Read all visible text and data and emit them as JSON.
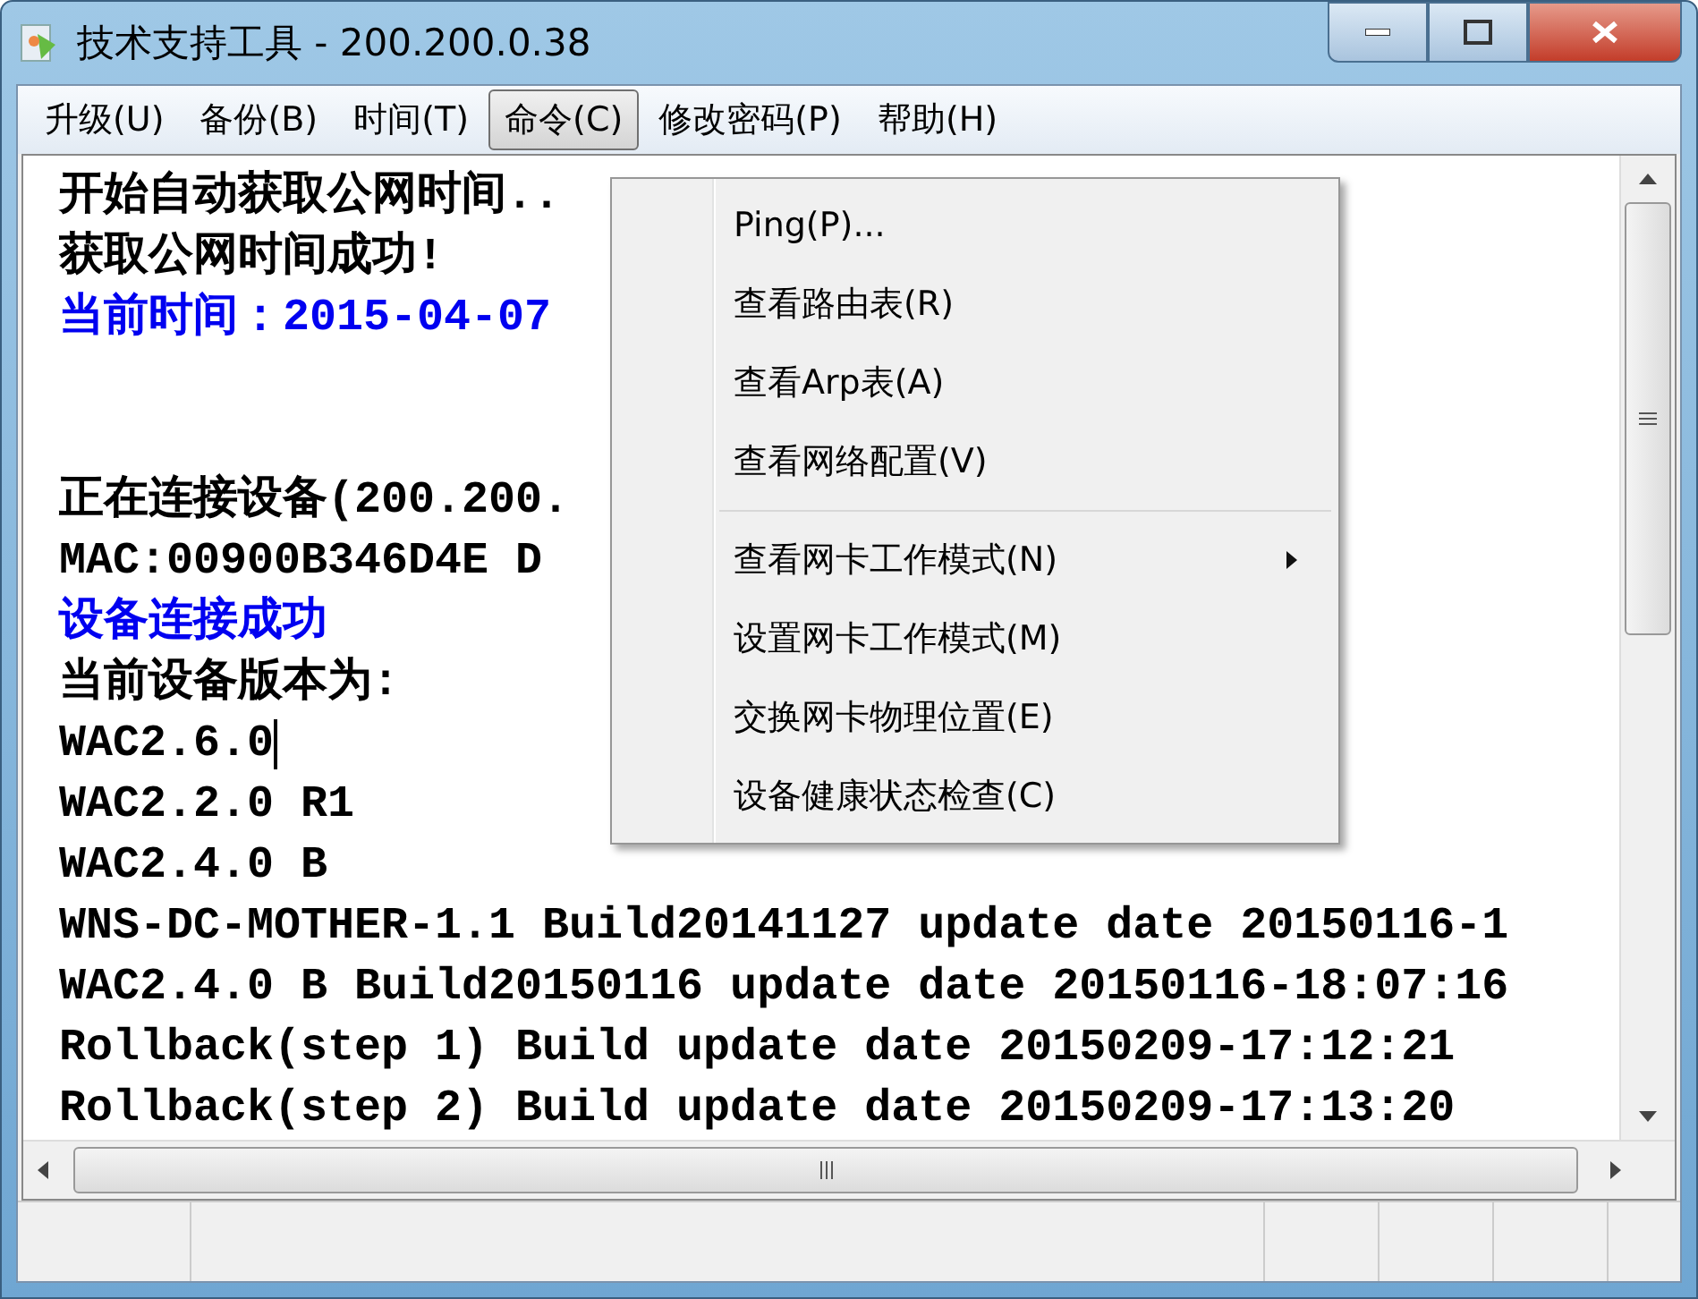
{
  "window": {
    "title": "技术支持工具 - 200.200.0.38"
  },
  "menubar": [
    {
      "label": "升级(U)",
      "selected": false
    },
    {
      "label": "备份(B)",
      "selected": false
    },
    {
      "label": "时间(T)",
      "selected": false
    },
    {
      "label": "命令(C)",
      "selected": true
    },
    {
      "label": "修改密码(P)",
      "selected": false
    },
    {
      "label": "帮助(H)",
      "selected": false
    }
  ],
  "log": [
    {
      "text": "开始自动获取公网时间..",
      "kind": "normal"
    },
    {
      "text": "获取公网时间成功!",
      "kind": "normal"
    },
    {
      "text": "当前时间：2015-04-07",
      "kind": "info"
    },
    {
      "kind": "blank"
    },
    {
      "kind": "blank"
    },
    {
      "text": "正在连接设备(200.200.",
      "kind": "normal"
    },
    {
      "text": "MAC:00900B346D4E  D",
      "kind": "normal"
    },
    {
      "text": "设备连接成功",
      "kind": "info"
    },
    {
      "text": "当前设备版本为:",
      "kind": "normal"
    },
    {
      "text": "WAC2.6.0",
      "kind": "caret"
    },
    {
      "text": "WAC2.2.0 R1",
      "kind": "normal"
    },
    {
      "text": "WAC2.4.0 B",
      "kind": "normal"
    },
    {
      "text": "WNS-DC-MOTHER-1.1 Build20141127 update date 20150116-1",
      "kind": "normal"
    },
    {
      "text": "WAC2.4.0 B Build20150116 update date 20150116-18:07:16",
      "kind": "normal"
    },
    {
      "text": "Rollback(step 1) Build update date 20150209-17:12:21",
      "kind": "normal"
    },
    {
      "text": "Rollback(step 2) Build update date 20150209-17:13:20",
      "kind": "normal"
    }
  ],
  "dropdown": [
    {
      "label": "Ping(P)...",
      "kind": "item"
    },
    {
      "label": "查看路由表(R)",
      "kind": "item"
    },
    {
      "label": "查看Arp表(A)",
      "kind": "item"
    },
    {
      "label": "查看网络配置(V)",
      "kind": "item"
    },
    {
      "kind": "separator"
    },
    {
      "label": "查看网卡工作模式(N)",
      "kind": "submenu"
    },
    {
      "label": "设置网卡工作模式(M)",
      "kind": "item"
    },
    {
      "label": "交换网卡物理位置(E)",
      "kind": "item"
    },
    {
      "label": "设备健康状态检查(C)",
      "kind": "item"
    }
  ]
}
